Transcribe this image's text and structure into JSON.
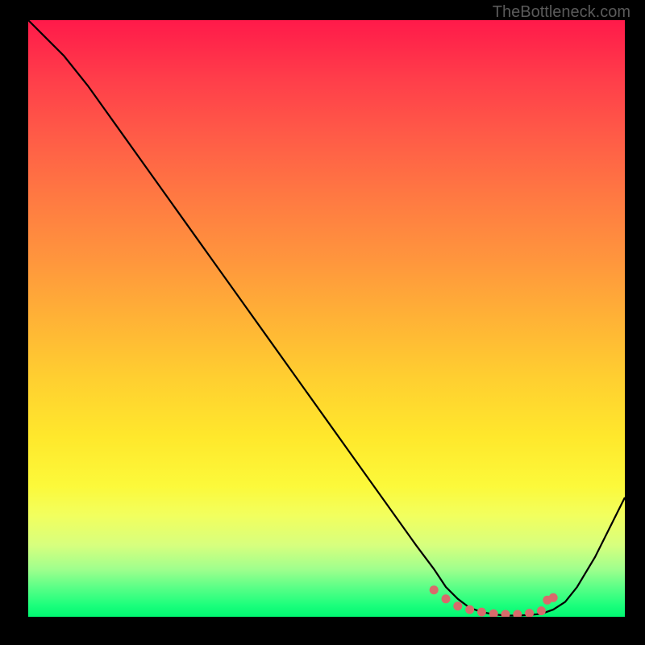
{
  "watermark": "TheBottleneck.com",
  "chart_data": {
    "type": "line",
    "title": "",
    "xlabel": "",
    "ylabel": "",
    "xlim": [
      0,
      100
    ],
    "ylim": [
      0,
      100
    ],
    "series": [
      {
        "name": "bottleneck-curve",
        "x": [
          0,
          3,
          6,
          10,
          15,
          20,
          25,
          30,
          35,
          40,
          45,
          50,
          55,
          60,
          65,
          68,
          70,
          72,
          74,
          76,
          78,
          80,
          82,
          84,
          86,
          88,
          90,
          92,
          95,
          98,
          100
        ],
        "values": [
          100,
          97,
          94,
          89,
          82,
          75,
          68,
          61,
          54,
          47,
          40,
          33,
          26,
          19,
          12,
          8,
          5,
          3,
          1.5,
          0.8,
          0.4,
          0.2,
          0.2,
          0.3,
          0.5,
          1.2,
          2.5,
          5,
          10,
          16,
          20
        ]
      }
    ],
    "markers": {
      "name": "valley-dots",
      "color": "#d86b6b",
      "x": [
        68,
        70,
        72,
        74,
        76,
        78,
        80,
        82,
        84,
        86,
        87,
        88
      ],
      "values": [
        4.5,
        3,
        1.8,
        1.2,
        0.8,
        0.5,
        0.4,
        0.4,
        0.6,
        1.0,
        2.8,
        3.2
      ]
    },
    "gradient_stops": [
      {
        "pct": 0,
        "color": "#ff1a4a"
      },
      {
        "pct": 50,
        "color": "#ffb236"
      },
      {
        "pct": 80,
        "color": "#fcf93a"
      },
      {
        "pct": 100,
        "color": "#00f771"
      }
    ]
  }
}
